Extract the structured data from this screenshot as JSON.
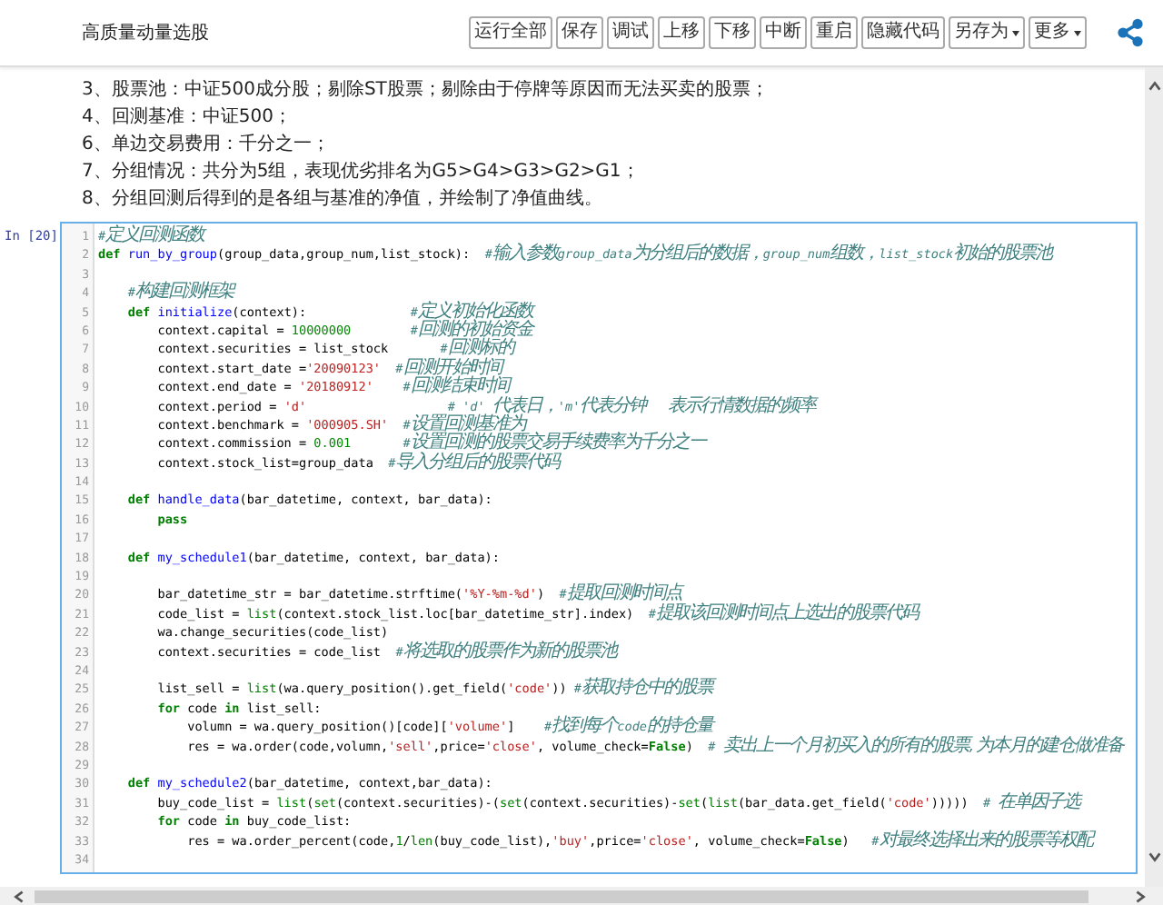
{
  "title": "高质量动量选股",
  "toolbar": [
    {
      "label": "运行全部",
      "dropdown": false
    },
    {
      "label": "保存",
      "dropdown": false
    },
    {
      "label": "调试",
      "dropdown": false
    },
    {
      "label": "上移",
      "dropdown": false
    },
    {
      "label": "下移",
      "dropdown": false
    },
    {
      "label": "中断",
      "dropdown": false
    },
    {
      "label": "重启",
      "dropdown": false
    },
    {
      "label": "隐藏代码",
      "dropdown": false
    },
    {
      "label": "另存为",
      "dropdown": true
    },
    {
      "label": "更多",
      "dropdown": true
    }
  ],
  "markdown": [
    "3、股票池：中证500成分股；剔除ST股票；剔除由于停牌等原因而无法买卖的股票；",
    "4、回测基准：中证500；",
    "6、单边交易费用：千分之一；",
    "7、分组情况：共分为5组，表现优劣排名为G5>G4>G3>G2>G1；",
    "8、分组回测后得到的是各组与基准的净值，并绘制了净值曲线。"
  ],
  "cell": {
    "prompt": "In [20]",
    "lines": [
      {
        "n": "1",
        "parts": [
          {
            "kind": "comment",
            "text": "#定义回测函数"
          }
        ]
      },
      {
        "n": "2",
        "parts": [
          {
            "kind": "keyword",
            "text": "def "
          },
          {
            "kind": "function",
            "text": "run_by_group"
          },
          {
            "kind": "plain",
            "text": "(group_data,group_num,list_stock):  "
          },
          {
            "kind": "comment",
            "text": "#输入参数group_data为分组后的数据，group_num组数，list_stock初始的股票池"
          }
        ]
      },
      {
        "n": "3"
      },
      {
        "n": "4",
        "parts": [
          {
            "kind": "comment",
            "text": "    #构建回测框架"
          }
        ]
      },
      {
        "n": "5",
        "parts": [
          {
            "kind": "keyword",
            "text": "    def "
          },
          {
            "kind": "function",
            "text": "initialize"
          },
          {
            "kind": "plain",
            "text": "(context):              "
          },
          {
            "kind": "comment",
            "text": "#定义初始化函数"
          }
        ]
      },
      {
        "n": "6",
        "parts": [
          {
            "kind": "plain",
            "text": "        context.capital = "
          },
          {
            "kind": "number",
            "text": "10000000"
          },
          {
            "kind": "comment",
            "text": "        #回测的初始资金"
          }
        ]
      },
      {
        "n": "7",
        "parts": [
          {
            "kind": "plain",
            "text": "        context.securities = list_stock       "
          },
          {
            "kind": "comment",
            "text": "#回测标的"
          }
        ]
      },
      {
        "n": "8",
        "parts": [
          {
            "kind": "plain",
            "text": "        context.start_date ="
          },
          {
            "kind": "string",
            "text": "'20090123'"
          },
          {
            "kind": "comment",
            "text": "  #回测开始时间"
          }
        ]
      },
      {
        "n": "9",
        "parts": [
          {
            "kind": "plain",
            "text": "        context.end_date = "
          },
          {
            "kind": "string",
            "text": "'20180912'"
          },
          {
            "kind": "comment",
            "text": "    #回测结束时间"
          }
        ]
      },
      {
        "n": "10",
        "parts": [
          {
            "kind": "plain",
            "text": "        context.period = "
          },
          {
            "kind": "string",
            "text": "'d'"
          },
          {
            "kind": "comment",
            "text": "                   # 'd' 代表日，'m'代表分钟   表示行情数据的频率"
          }
        ]
      },
      {
        "n": "11",
        "parts": [
          {
            "kind": "plain",
            "text": "        context.benchmark = "
          },
          {
            "kind": "string",
            "text": "'000905.SH'"
          },
          {
            "kind": "comment",
            "text": "  #设置回测基准为"
          }
        ]
      },
      {
        "n": "12",
        "parts": [
          {
            "kind": "plain",
            "text": "        context.commission = "
          },
          {
            "kind": "number",
            "text": "0.001"
          },
          {
            "kind": "comment",
            "text": "       #设置回测的股票交易手续费率为千分之一"
          }
        ]
      },
      {
        "n": "13",
        "parts": [
          {
            "kind": "plain",
            "text": "        context.stock_list=group_data  "
          },
          {
            "kind": "comment",
            "text": "#导入分组后的股票代码"
          }
        ]
      },
      {
        "n": "14"
      },
      {
        "n": "15",
        "parts": [
          {
            "kind": "keyword",
            "text": "    def "
          },
          {
            "kind": "function",
            "text": "handle_data"
          },
          {
            "kind": "plain",
            "text": "(bar_datetime, context, bar_data):"
          }
        ]
      },
      {
        "n": "16",
        "parts": [
          {
            "kind": "keyword",
            "text": "        pass"
          }
        ]
      },
      {
        "n": "17"
      },
      {
        "n": "18",
        "parts": [
          {
            "kind": "keyword",
            "text": "    def "
          },
          {
            "kind": "function",
            "text": "my_schedule1"
          },
          {
            "kind": "plain",
            "text": "(bar_datetime, context, bar_data):"
          }
        ]
      },
      {
        "n": "19"
      },
      {
        "n": "20",
        "parts": [
          {
            "kind": "plain",
            "text": "        bar_datetime_str = bar_datetime.strftime("
          },
          {
            "kind": "string",
            "text": "'%Y-%m-%d'"
          },
          {
            "kind": "plain",
            "text": ")  "
          },
          {
            "kind": "comment",
            "text": "#提取回测时间点"
          }
        ]
      },
      {
        "n": "21",
        "parts": [
          {
            "kind": "plain",
            "text": "        code_list = "
          },
          {
            "kind": "builtin",
            "text": "list"
          },
          {
            "kind": "plain",
            "text": "(context.stock_list.loc[bar_datetime_str].index)  "
          },
          {
            "kind": "comment",
            "text": "#提取该回测时间点上选出的股票代码"
          }
        ]
      },
      {
        "n": "22",
        "parts": [
          {
            "kind": "plain",
            "text": "        wa.change_securities(code_list)"
          }
        ]
      },
      {
        "n": "23",
        "parts": [
          {
            "kind": "plain",
            "text": "        context.securities = code_list  "
          },
          {
            "kind": "comment",
            "text": "#将选取的股票作为新的股票池"
          }
        ]
      },
      {
        "n": "24"
      },
      {
        "n": "25",
        "parts": [
          {
            "kind": "plain",
            "text": "        list_sell = "
          },
          {
            "kind": "builtin",
            "text": "list"
          },
          {
            "kind": "plain",
            "text": "(wa.query_position().get_field("
          },
          {
            "kind": "string",
            "text": "'code'"
          },
          {
            "kind": "plain",
            "text": ")) "
          },
          {
            "kind": "comment",
            "text": "#获取持仓中的股票"
          }
        ]
      },
      {
        "n": "26",
        "parts": [
          {
            "kind": "keyword",
            "text": "        for"
          },
          {
            "kind": "plain",
            "text": " code "
          },
          {
            "kind": "keyword",
            "text": "in"
          },
          {
            "kind": "plain",
            "text": " list_sell:"
          }
        ]
      },
      {
        "n": "27",
        "parts": [
          {
            "kind": "plain",
            "text": "            volumn = wa.query_position()[code]["
          },
          {
            "kind": "string",
            "text": "'volume'"
          },
          {
            "kind": "plain",
            "text": "]    "
          },
          {
            "kind": "comment",
            "text": "#找到每个code的持仓量"
          }
        ]
      },
      {
        "n": "28",
        "parts": [
          {
            "kind": "plain",
            "text": "            res = wa.order(code,volumn,"
          },
          {
            "kind": "string",
            "text": "'sell'"
          },
          {
            "kind": "plain",
            "text": ",price="
          },
          {
            "kind": "string",
            "text": "'close'"
          },
          {
            "kind": "plain",
            "text": ", volume_check="
          },
          {
            "kind": "keyword",
            "text": "False"
          },
          {
            "kind": "plain",
            "text": ")  "
          },
          {
            "kind": "comment",
            "text": "# 卖出上一个月初买入的所有的股票,为本月的建仓做准备"
          }
        ]
      },
      {
        "n": "29"
      },
      {
        "n": "30",
        "parts": [
          {
            "kind": "keyword",
            "text": "    def "
          },
          {
            "kind": "function",
            "text": "my_schedule2"
          },
          {
            "kind": "plain",
            "text": "(bar_datetime, context,bar_data):"
          }
        ]
      },
      {
        "n": "31",
        "parts": [
          {
            "kind": "plain",
            "text": "        buy_code_list = "
          },
          {
            "kind": "builtin",
            "text": "list"
          },
          {
            "kind": "plain",
            "text": "("
          },
          {
            "kind": "builtin",
            "text": "set"
          },
          {
            "kind": "plain",
            "text": "(context.securities)-("
          },
          {
            "kind": "builtin",
            "text": "set"
          },
          {
            "kind": "plain",
            "text": "(context.securities)-"
          },
          {
            "kind": "builtin",
            "text": "set"
          },
          {
            "kind": "plain",
            "text": "("
          },
          {
            "kind": "builtin",
            "text": "list"
          },
          {
            "kind": "plain",
            "text": "(bar_data.get_field("
          },
          {
            "kind": "string",
            "text": "'code'"
          },
          {
            "kind": "plain",
            "text": ")))))  "
          },
          {
            "kind": "comment",
            "text": "# 在单因子选"
          }
        ]
      },
      {
        "n": "32",
        "parts": [
          {
            "kind": "keyword",
            "text": "        for"
          },
          {
            "kind": "plain",
            "text": " code "
          },
          {
            "kind": "keyword",
            "text": "in"
          },
          {
            "kind": "plain",
            "text": " buy_code_list:"
          }
        ]
      },
      {
        "n": "33",
        "parts": [
          {
            "kind": "plain",
            "text": "            res = wa.order_percent(code,"
          },
          {
            "kind": "number",
            "text": "1"
          },
          {
            "kind": "plain",
            "text": "/"
          },
          {
            "kind": "builtin",
            "text": "len"
          },
          {
            "kind": "plain",
            "text": "(buy_code_list),"
          },
          {
            "kind": "string",
            "text": "'buy'"
          },
          {
            "kind": "plain",
            "text": ",price="
          },
          {
            "kind": "string",
            "text": "'close'"
          },
          {
            "kind": "plain",
            "text": ", volume_check="
          },
          {
            "kind": "keyword",
            "text": "False"
          },
          {
            "kind": "plain",
            "text": ")   "
          },
          {
            "kind": "comment",
            "text": "#对最终选择出来的股票等权配"
          }
        ]
      },
      {
        "n": "34"
      }
    ]
  }
}
